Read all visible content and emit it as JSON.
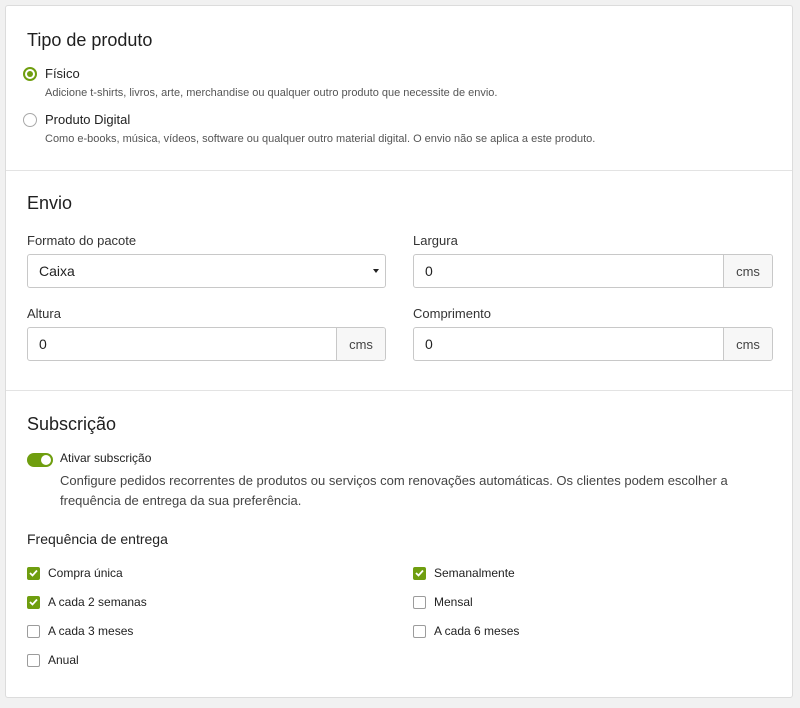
{
  "product_type": {
    "title": "Tipo de produto",
    "options": [
      {
        "label": "Físico",
        "description": "Adicione t-shirts, livros, arte, merchandise ou qualquer outro produto que necessite de envio.",
        "selected": true
      },
      {
        "label": "Produto Digital",
        "description": "Como e-books, música, vídeos, software ou qualquer outro material digital. O envio não se aplica a este produto.",
        "selected": false
      }
    ]
  },
  "shipping": {
    "title": "Envio",
    "package_format": {
      "label": "Formato do pacote",
      "value": "Caixa"
    },
    "width": {
      "label": "Largura",
      "value": "0",
      "unit": "cms"
    },
    "height": {
      "label": "Altura",
      "value": "0",
      "unit": "cms"
    },
    "length": {
      "label": "Comprimento",
      "value": "0",
      "unit": "cms"
    }
  },
  "subscription": {
    "title": "Subscrição",
    "toggle": {
      "label": "Ativar subscrição",
      "enabled": true
    },
    "description": "Configure pedidos recorrentes de produtos ou serviços com renovações automáticas. Os clientes podem escolher a frequência de entrega da sua preferência.",
    "frequency_label": "Frequência de entrega",
    "frequencies": [
      {
        "label": "Compra única",
        "checked": true
      },
      {
        "label": "Semanalmente",
        "checked": true
      },
      {
        "label": "A cada 2 semanas",
        "checked": true
      },
      {
        "label": "Mensal",
        "checked": false
      },
      {
        "label": "A cada 3 meses",
        "checked": false
      },
      {
        "label": "A cada 6 meses",
        "checked": false
      },
      {
        "label": "Anual",
        "checked": false
      }
    ]
  },
  "colors": {
    "accent": "#6f9e0f",
    "border": "#c8c8c8",
    "background": "#f1f1f1"
  }
}
